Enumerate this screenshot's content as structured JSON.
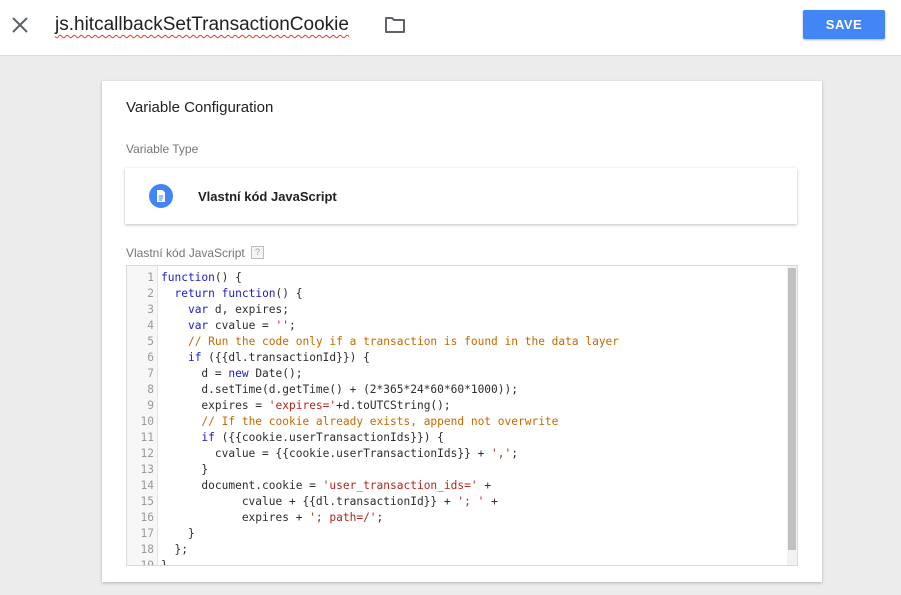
{
  "header": {
    "title": "js.hitcallbackSetTransactionCookie",
    "save_label": "SAVE",
    "close_icon": "close-icon",
    "folder_icon": "folder-icon"
  },
  "config": {
    "title": "Variable Configuration",
    "type_label": "Variable Type",
    "type_name": "Vlastní kód JavaScript",
    "code_label": "Vlastní kód JavaScript",
    "help_text": "?"
  },
  "colors": {
    "accent": "#4285f4",
    "keyword": "#1c1ccc",
    "string": "#b3261e",
    "comment": "#c36a00"
  },
  "code": {
    "lines": [
      "function() {",
      "  return function() {",
      "    var d, expires;",
      "    var cvalue = '';",
      "    // Run the code only if a transaction is found in the data layer",
      "    if ({{dl.transactionId}}) {",
      "      d = new Date();",
      "      d.setTime(d.getTime() + (2*365*24*60*60*1000));",
      "      expires = 'expires='+d.toUTCString();",
      "      // If the cookie already exists, append not overwrite",
      "      if ({{cookie.userTransactionIds}}) {",
      "        cvalue = {{cookie.userTransactionIds}} + ',';",
      "      }",
      "      document.cookie = 'user_transaction_ids=' +",
      "            cvalue + {{dl.transactionId}} + '; ' +",
      "            expires + '; path=/';",
      "    }",
      "  };",
      "}"
    ]
  }
}
